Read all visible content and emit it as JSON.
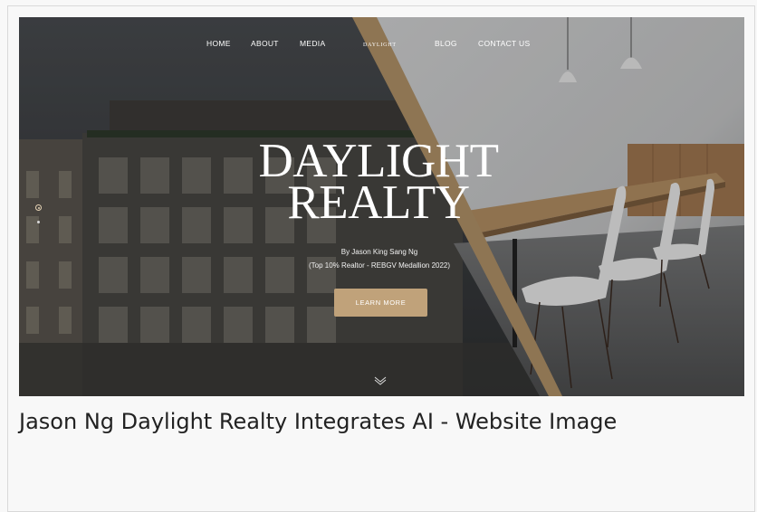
{
  "nav": {
    "items": [
      "HOME",
      "ABOUT",
      "MEDIA",
      "BLOG",
      "CONTACT US"
    ],
    "logo": "DAYLIGHT"
  },
  "hero": {
    "title_line1": "DAYLIGHT",
    "title_line2": "REALTY",
    "byline_line1": "By Jason King Sang Ng",
    "byline_line2": "(Top 10% Realtor - REBGV Medallion 2022)",
    "cta_label": "LEARN MORE"
  },
  "caption": "Jason Ng Daylight Realty Integrates AI - Website Image",
  "colors": {
    "accent": "#c0a27a",
    "accent_stripe": "#b7976b"
  },
  "icons": [
    "slide-dot-active-icon",
    "slide-dot-icon",
    "chevron-down-icon"
  ]
}
